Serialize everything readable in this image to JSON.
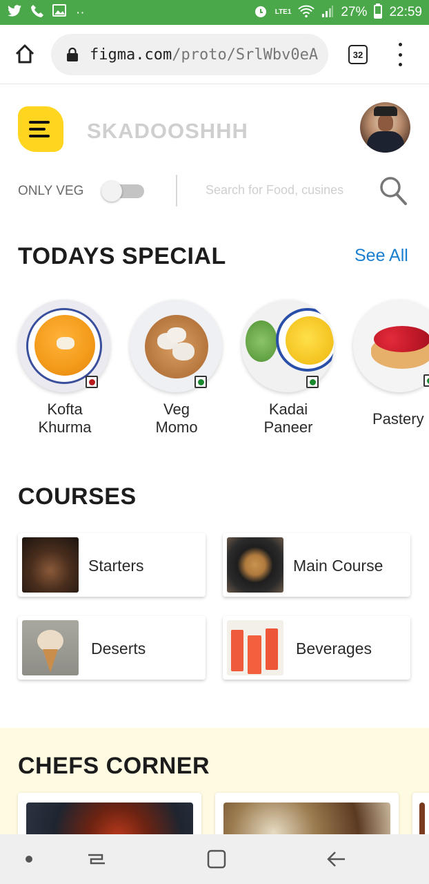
{
  "status_bar": {
    "battery": "27%",
    "time": "22:59",
    "network": "LTE1",
    "icons": [
      "twitter-icon",
      "phone-icon",
      "image-icon",
      "dots-icon",
      "alarm-icon",
      "volte-icon",
      "wifi-icon",
      "signal-icon",
      "battery-icon"
    ]
  },
  "browser": {
    "url_host": "figma.com",
    "url_path": "/proto/SrlWbv0eA",
    "tab_count": "32"
  },
  "header": {
    "brand": "SKADOOSHHH"
  },
  "filters": {
    "only_veg_label": "ONLY VEG",
    "only_veg_on": false,
    "search_placeholder": "Search for Food, cusines"
  },
  "todays_special": {
    "title": "TODAYS SPECIAL",
    "see_all": "See All",
    "items": [
      {
        "name_line1": "Kofta",
        "name_line2": "Khurma",
        "veg": false
      },
      {
        "name_line1": "Veg",
        "name_line2": "Momo",
        "veg": true
      },
      {
        "name_line1": "Kadai",
        "name_line2": "Paneer",
        "veg": true
      },
      {
        "name_line1": "Pastery",
        "name_line2": "",
        "veg": true
      }
    ]
  },
  "courses": {
    "title": "COURSES",
    "items": [
      {
        "label": "Starters"
      },
      {
        "label": "Main Course"
      },
      {
        "label": "Deserts"
      },
      {
        "label": "Beverages"
      }
    ]
  },
  "chefs_corner": {
    "title": "CHEFS CORNER"
  },
  "colors": {
    "status_bar": "#4aa84a",
    "accent_yellow": "#ffd51f",
    "link_blue": "#1a7fd1",
    "veg_green": "#1b8a2f",
    "nonveg_red": "#b81d1d",
    "chefs_bg": "#fffbe3"
  }
}
